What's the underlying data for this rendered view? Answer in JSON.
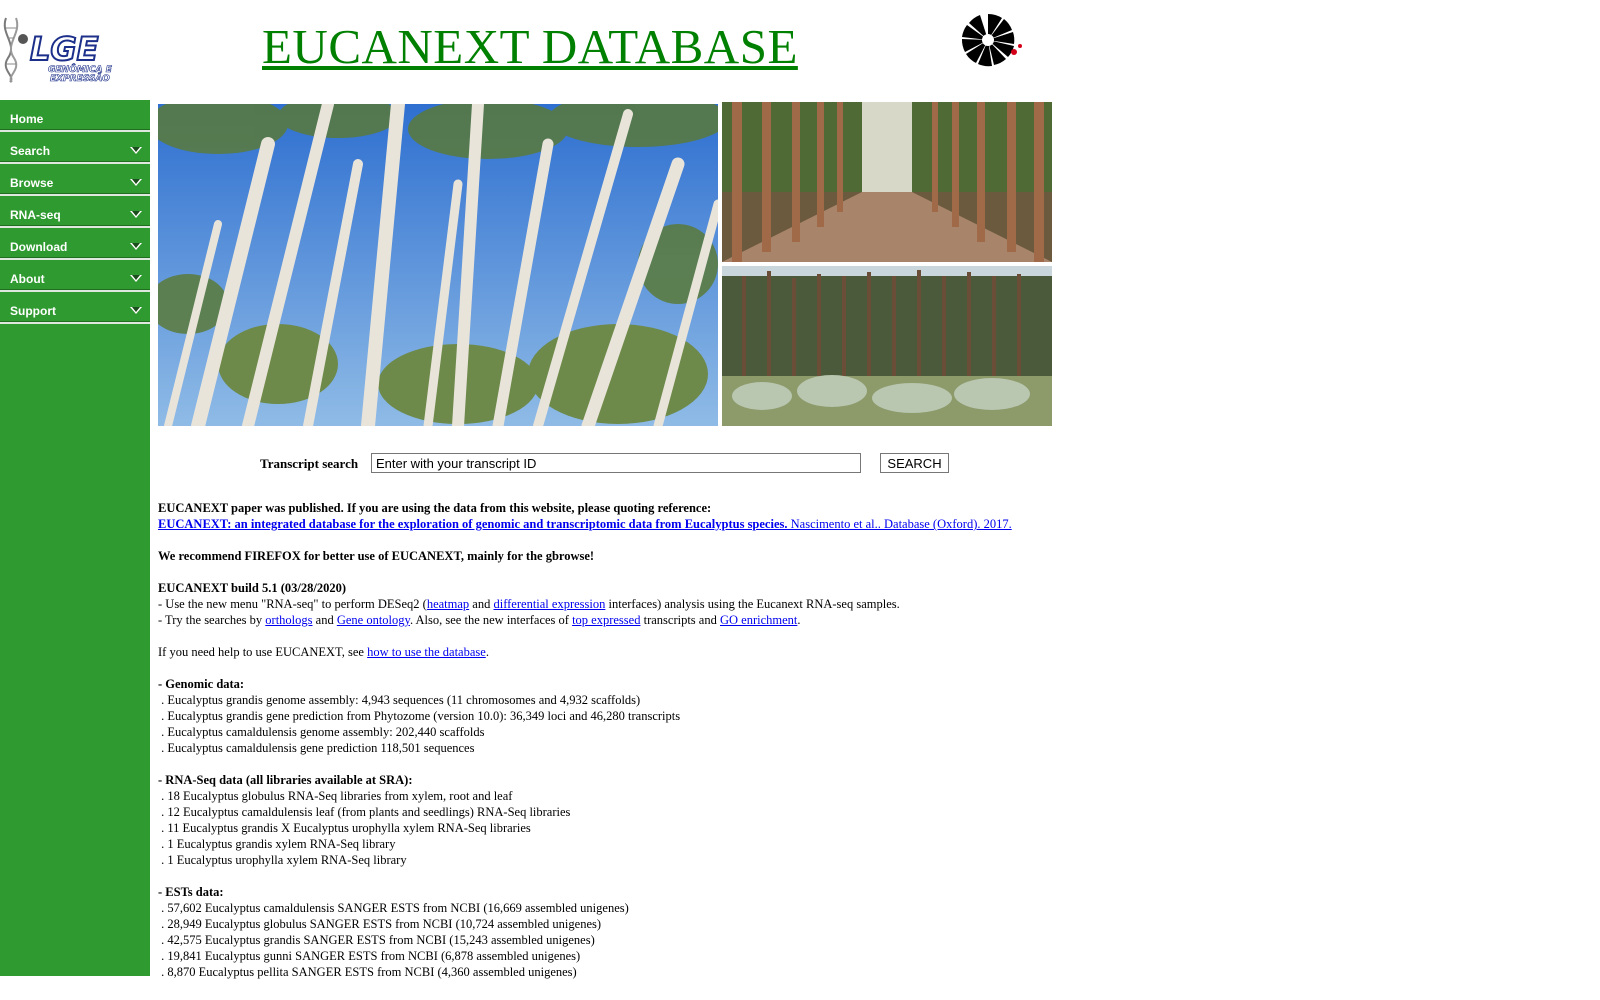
{
  "header": {
    "logo_text_main": "LGE",
    "logo_text_sub1": "GENÔMICA E",
    "logo_text_sub2": "EXPRESSÃO",
    "title": "EUCANEXT DATABASE"
  },
  "sidebar": {
    "items": [
      {
        "label": "Home",
        "has_arrow": false
      },
      {
        "label": "Search",
        "has_arrow": true
      },
      {
        "label": "Browse",
        "has_arrow": true
      },
      {
        "label": "RNA-seq",
        "has_arrow": true
      },
      {
        "label": "Download",
        "has_arrow": true
      },
      {
        "label": "About",
        "has_arrow": true
      },
      {
        "label": "Support",
        "has_arrow": true
      }
    ]
  },
  "search": {
    "label": "Transcript search",
    "input_value": "Enter with your transcript ID",
    "button_label": "SEARCH"
  },
  "content": {
    "paper_notice": "EUCANEXT paper was published. If you are using the data from this website, please quoting reference:",
    "paper_link_title": "EUCANEXT: an integrated database for the exploration of genomic and transcriptomic data from Eucalyptus species.",
    "paper_link_citation": " Nascimento et al.. Database (Oxford). 2017.",
    "firefox_note": "We recommend FIREFOX for better use of EUCANEXT, mainly for the gbrowse!",
    "build": "EUCANEXT build 5.1 (03/28/2020)",
    "line1_a": "- Use the new menu \"RNA-seq\" to perform DESeq2 (",
    "line1_link1": "heatmap",
    "line1_b": " and ",
    "line1_link2": "differential expression",
    "line1_c": " interfaces) analysis using the Eucanext RNA-seq samples.",
    "line2_a": "- Try the searches by ",
    "line2_link1": "orthologs",
    "line2_b": " and ",
    "line2_link2": "Gene ontology",
    "line2_c": ". Also, see the new interfaces of ",
    "line2_link3": "top expressed",
    "line2_d": " transcripts and ",
    "line2_link4": "GO enrichment",
    "line2_e": ".",
    "help_a": "If you need help to use EUCANEXT, see ",
    "help_link": "how to use the database",
    "help_b": ".",
    "genomic_heading": "- Genomic data:",
    "genomic": [
      " . Eucalyptus grandis genome assembly: 4,943 sequences (11 chromosomes and 4,932 scaffolds)",
      " . Eucalyptus grandis gene prediction from Phytozome (version 10.0): 36,349 loci and 46,280 transcripts",
      " . Eucalyptus camaldulensis genome assembly: 202,440 scaffolds",
      " . Eucalyptus camaldulensis gene prediction 118,501 sequences"
    ],
    "rnaseq_heading": "- RNA-Seq data (all libraries available at SRA):",
    "rnaseq": [
      " . 18 Eucalyptus globulus RNA-Seq libraries from xylem, root and leaf",
      " . 12 Eucalyptus camaldulensis leaf (from plants and seedlings) RNA-Seq libraries",
      " . 11 Eucalyptus grandis X Eucalyptus urophylla xylem RNA-Seq libraries",
      " . 1 Eucalyptus grandis xylem RNA-Seq library",
      " . 1 Eucalyptus urophylla xylem RNA-Seq library"
    ],
    "ests_heading": "- ESTs data:",
    "ests": [
      " . 57,602 Eucalyptus camaldulensis SANGER ESTS from NCBI (16,669 assembled unigenes)",
      " . 28,949 Eucalyptus globulus SANGER ESTS from NCBI (10,724 assembled unigenes)",
      " . 42,575 Eucalyptus grandis SANGER ESTS from NCBI (15,243 assembled unigenes)",
      " . 19,841 Eucalyptus gunni SANGER ESTS from NCBI (6,878 assembled unigenes)",
      " . 8,870 Eucalyptus pellita SANGER ESTS from NCBI (4,360 assembled unigenes)"
    ]
  },
  "colors": {
    "sidebar_green": "#2f9a2f",
    "title_green": "#008000",
    "link_blue": "#0000ee"
  }
}
